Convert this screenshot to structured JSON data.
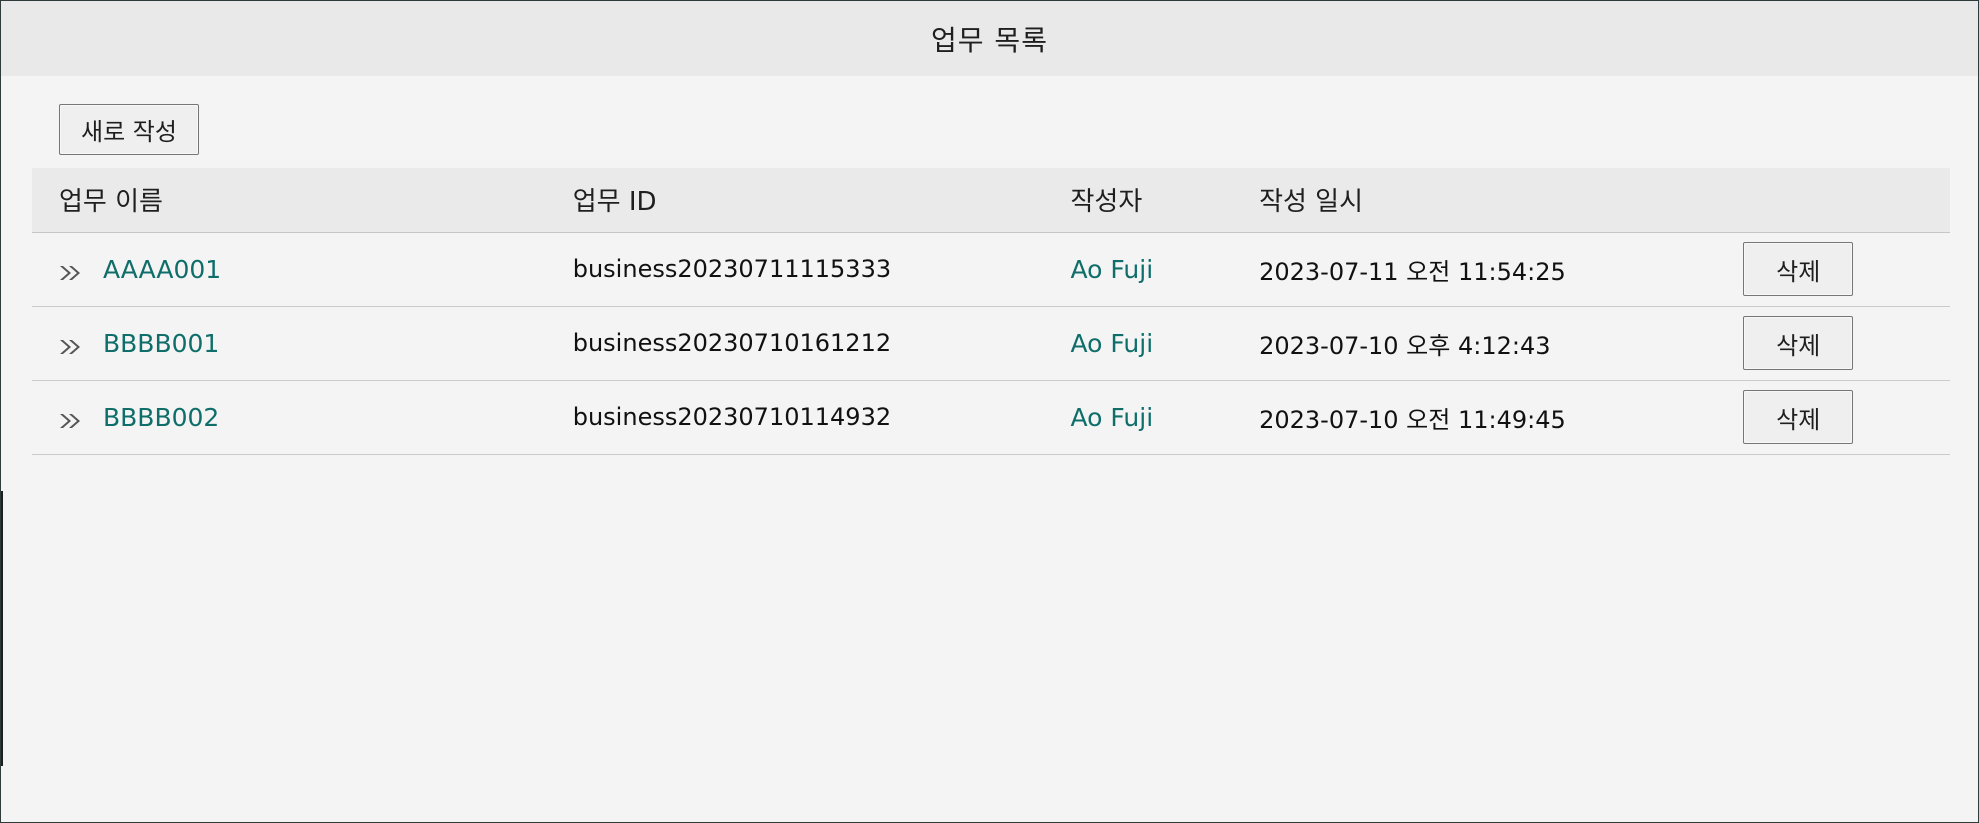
{
  "title": "업무 목록",
  "toolbar": {
    "new_label": "새로 작성"
  },
  "table": {
    "headers": {
      "name": "업무 이름",
      "id": "업무 ID",
      "author": "작성자",
      "created": "작성 일시"
    },
    "rows": [
      {
        "name": "AAAA001",
        "id": "business20230711115333",
        "author": "Ao Fuji",
        "created": "2023-07-11 오전 11:54:25",
        "delete_label": "삭제"
      },
      {
        "name": "BBBB001",
        "id": "business20230710161212",
        "author": "Ao Fuji",
        "created": "2023-07-10 오후 4:12:43",
        "delete_label": "삭제"
      },
      {
        "name": "BBBB002",
        "id": "business20230710114932",
        "author": "Ao Fuji",
        "created": "2023-07-10 오전 11:49:45",
        "delete_label": "삭제"
      }
    ]
  },
  "colors": {
    "link": "#0f6e6a",
    "title_bar": "#e9e9e9",
    "header_bg": "#eaeaea",
    "page_bg": "#f4f4f4"
  },
  "icons": {
    "row_marker": "double-chevron-right-icon"
  }
}
